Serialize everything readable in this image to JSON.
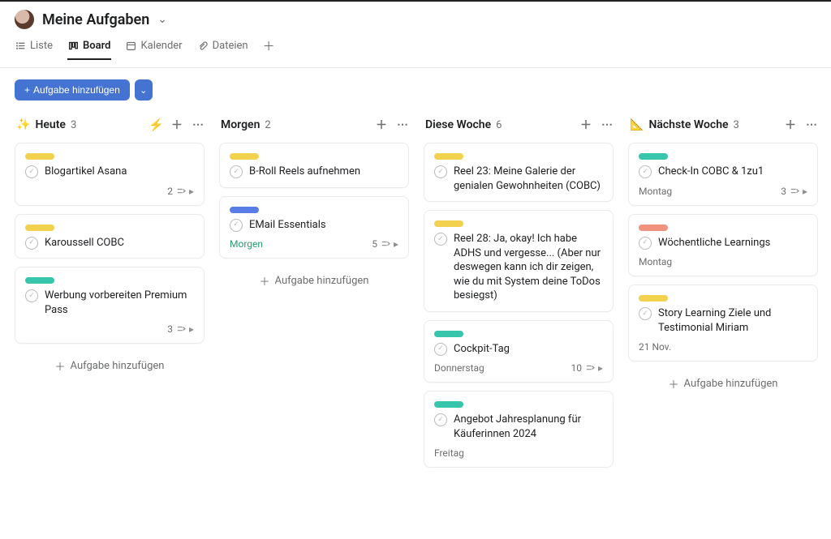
{
  "header": {
    "title": "Meine Aufgaben"
  },
  "tabs": {
    "list": "Liste",
    "board": "Board",
    "calendar": "Kalender",
    "files": "Dateien"
  },
  "toolbar": {
    "add_task": "Aufgabe hinzufügen"
  },
  "add_card_label": "Aufgabe hinzufügen",
  "columns": [
    {
      "emoji": "✨",
      "title": "Heute",
      "count": "3",
      "bolt": true,
      "cards": [
        {
          "pill": "yellow",
          "title": "Blogartikel Asana",
          "meta_left": "",
          "meta_count": "2"
        },
        {
          "pill": "yellow",
          "title": "Karoussell COBC",
          "meta_left": "",
          "meta_count": ""
        },
        {
          "pill": "teal",
          "title": "Werbung vorbereiten Premium Pass",
          "meta_left": "",
          "meta_count": "3"
        }
      ]
    },
    {
      "emoji": "",
      "title": "Morgen",
      "count": "2",
      "bolt": false,
      "cards": [
        {
          "pill": "yellow",
          "title": "B-Roll Reels aufnehmen",
          "meta_left": "",
          "meta_count": ""
        },
        {
          "pill": "blue",
          "title": "EMail Essentials",
          "meta_left": "Morgen",
          "meta_left_green": true,
          "meta_count": "5"
        }
      ]
    },
    {
      "emoji": "",
      "title": "Diese Woche",
      "count": "6",
      "bolt": false,
      "cards": [
        {
          "pill": "yellow",
          "title": "Reel 23: Meine Galerie der genialen Gewohnheiten (COBC)",
          "meta_left": "",
          "meta_count": ""
        },
        {
          "pill": "yellow",
          "title": "Reel 28: Ja, okay! Ich habe ADHS und vergesse... (Aber nur deswegen kann ich dir zeigen, wie du mit System deine ToDos besiegst)",
          "meta_left": "",
          "meta_count": ""
        },
        {
          "pill": "teal",
          "title": "Cockpit-Tag",
          "meta_left": "Donnerstag",
          "meta_count": "10"
        },
        {
          "pill": "teal",
          "title": "Angebot Jahresplanung für Käuferinnen 2024",
          "meta_left": "Freitag",
          "meta_count": ""
        }
      ]
    },
    {
      "emoji": "📐",
      "title": "Nächste Woche",
      "count": "3",
      "bolt": false,
      "cards": [
        {
          "pill": "teal",
          "title": "Check-In COBC & 1zu1",
          "meta_left": "Montag",
          "meta_count": "3"
        },
        {
          "pill": "orange",
          "title": "Wöchentliche Learnings",
          "meta_left": "Montag",
          "meta_count": ""
        },
        {
          "pill": "yellow",
          "title": "Story Learning Ziele und Testimonial Miriam",
          "meta_left": "21 Nov.",
          "meta_count": ""
        }
      ]
    }
  ]
}
